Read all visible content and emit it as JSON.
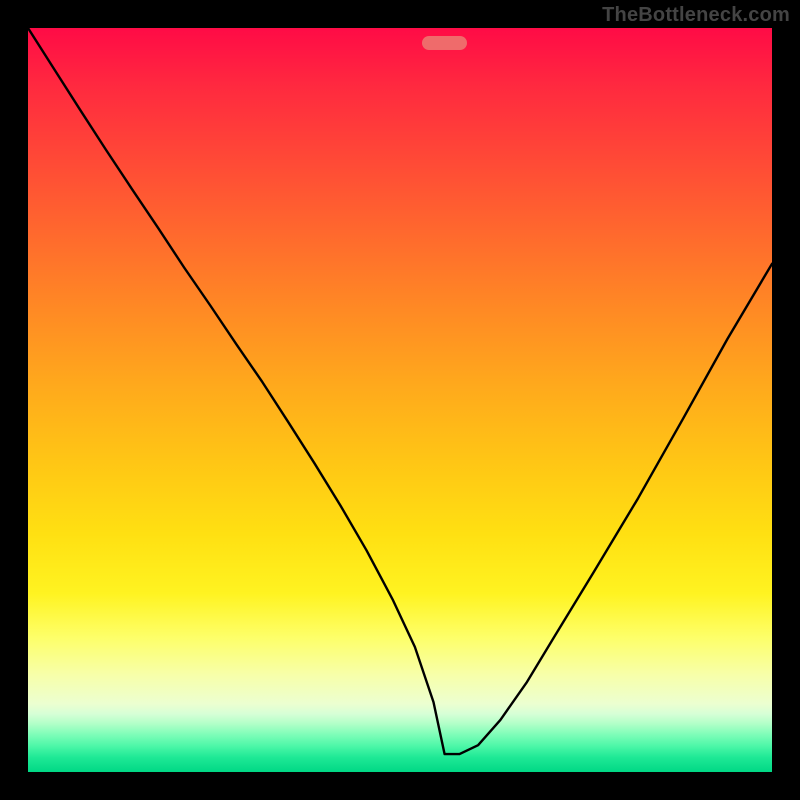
{
  "watermark": "TheBottleneck.com",
  "colors": {
    "background": "#000000",
    "curve": "#000000",
    "marker": "#ef6b6b",
    "gradient_stops": [
      "#ff0b46",
      "#ff2a3f",
      "#ff4a36",
      "#ff6a2d",
      "#ff8a24",
      "#ffa91c",
      "#ffc515",
      "#ffe012",
      "#fff321",
      "#fdff6a",
      "#f7ffaa",
      "#ecffd0",
      "#d6ffd6",
      "#b2ffc8",
      "#7dfdb8",
      "#4df7a8",
      "#1fe996",
      "#00d885"
    ]
  },
  "marker": {
    "x_frac": 0.56,
    "y_frac": 0.98,
    "w_frac": 0.06,
    "h_frac": 0.018
  },
  "chart_data": {
    "type": "line",
    "title": "",
    "xlabel": "",
    "ylabel": "",
    "xlim": [
      0,
      1
    ],
    "ylim": [
      0,
      1
    ],
    "x": [
      0.0,
      0.035,
      0.07,
      0.105,
      0.14,
      0.175,
      0.21,
      0.245,
      0.28,
      0.315,
      0.35,
      0.385,
      0.42,
      0.455,
      0.49,
      0.52,
      0.545,
      0.56,
      0.58,
      0.605,
      0.635,
      0.67,
      0.71,
      0.76,
      0.82,
      0.88,
      0.94,
      1.0
    ],
    "values": [
      1.0,
      0.945,
      0.89,
      0.836,
      0.783,
      0.731,
      0.678,
      0.627,
      0.575,
      0.524,
      0.47,
      0.415,
      0.358,
      0.298,
      0.232,
      0.168,
      0.094,
      0.024,
      0.024,
      0.036,
      0.07,
      0.12,
      0.186,
      0.268,
      0.368,
      0.474,
      0.582,
      0.683
    ],
    "annotations": [
      {
        "text": "TheBottleneck.com",
        "pos": "top-right"
      }
    ],
    "marker_region": {
      "x0": 0.53,
      "x1": 0.59,
      "y": 0.02
    }
  }
}
